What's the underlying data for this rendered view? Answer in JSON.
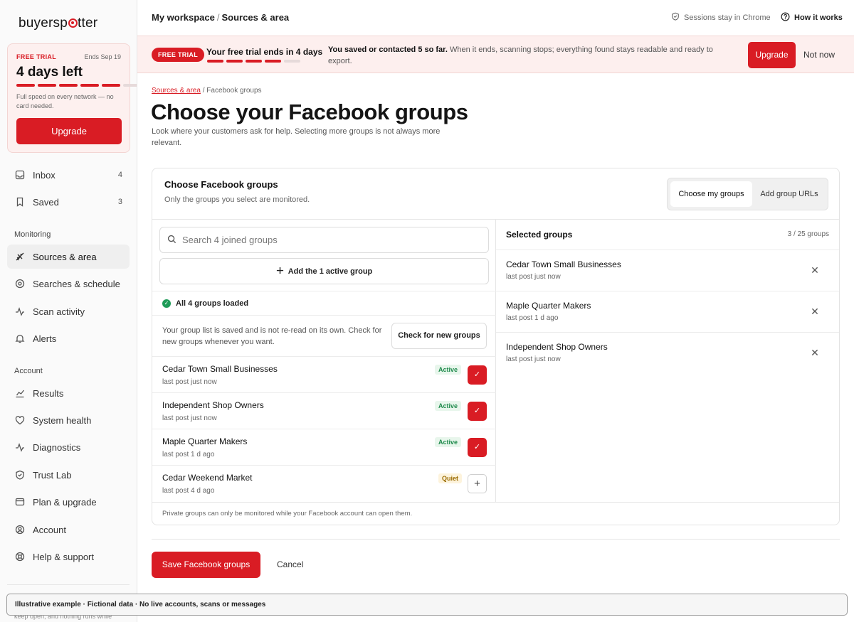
{
  "sidebar": {
    "logo_before": "buyersp",
    "logo_after": "tter",
    "trial": {
      "label": "FREE TRIAL",
      "ends": "Ends Sep 19",
      "days_left": "4 days left",
      "progress_filled_segments": 5,
      "progress_total_segments": 6,
      "note": "Full speed on every network — no card needed.",
      "upgrade_label": "Upgrade"
    },
    "top_items": [
      {
        "label": "Inbox",
        "count": "4",
        "icon": "inbox-icon"
      },
      {
        "label": "Saved",
        "count": "3",
        "icon": "bookmark-icon"
      }
    ],
    "monitoring_heading": "Monitoring",
    "monitoring_items": [
      {
        "label": "Sources & area",
        "icon": "radar-icon",
        "active": true
      },
      {
        "label": "Searches & schedule",
        "icon": "target-icon"
      },
      {
        "label": "Scan activity",
        "icon": "activity-icon"
      },
      {
        "label": "Alerts",
        "icon": "bell-icon"
      }
    ],
    "account_heading": "Account",
    "account_items": [
      {
        "label": "Results",
        "icon": "chart-icon"
      },
      {
        "label": "System health",
        "icon": "heart-icon"
      },
      {
        "label": "Diagnostics",
        "icon": "pulse-icon"
      },
      {
        "label": "Trust Lab",
        "icon": "shield-icon"
      },
      {
        "label": "Plan & upgrade",
        "icon": "card-icon"
      },
      {
        "label": "Account",
        "icon": "user-icon"
      },
      {
        "label": "Help & support",
        "icon": "lifebuoy-icon"
      }
    ],
    "footer_text": "keep open, and nothing runs while"
  },
  "topbar": {
    "breadcrumb_root": "My workspace",
    "breadcrumb_sep": "/",
    "breadcrumb_current": "Sources & area",
    "sessions_text": "Sessions stay in Chrome",
    "how_it_works": "How it works"
  },
  "banner": {
    "pill": "FREE TRIAL",
    "title": "Your free trial ends in 4 days",
    "progress_filled_segments": 5,
    "progress_total_segments": 6,
    "message_bold": "You saved or contacted 5 so far.",
    "message_rest": " When it ends, scanning stops; everything found stays readable and ready to export.",
    "upgrade_label": "Upgrade",
    "not_now_label": "Not now"
  },
  "main": {
    "subcrumb_link": "Sources & area",
    "subcrumb_rest": " / Facebook groups",
    "title": "Choose your Facebook groups",
    "description": "Look where your customers ask for help. Selecting more groups is not always more relevant.",
    "card": {
      "heading": "Choose Facebook groups",
      "subheading": "Only the groups you select are monitored.",
      "tab_mine": "Choose my groups",
      "tab_urls": "Add group URLs",
      "search_placeholder": "Search 4 joined groups",
      "add_active_label": "Add the 1 active group",
      "loaded_label": "All 4 groups loaded",
      "info_text": "Your group list is saved and is not re-read on its own. Check for new groups whenever you want.",
      "check_new_label": "Check for new groups",
      "groups": [
        {
          "name": "Cedar Town Small Businesses",
          "last_post": "last post just now",
          "status": "Active",
          "selected": true
        },
        {
          "name": "Independent Shop Owners",
          "last_post": "last post just now",
          "status": "Active",
          "selected": true
        },
        {
          "name": "Maple Quarter Makers",
          "last_post": "last post 1 d ago",
          "status": "Active",
          "selected": true
        },
        {
          "name": "Cedar Weekend Market",
          "last_post": "last post 4 d ago",
          "status": "Quiet",
          "selected": false
        }
      ],
      "selected_heading": "Selected groups",
      "selected_count": "3 / 25 groups",
      "selected": [
        {
          "name": "Cedar Town Small Businesses",
          "last_post": "last post just now"
        },
        {
          "name": "Maple Quarter Makers",
          "last_post": "last post 1 d ago"
        },
        {
          "name": "Independent Shop Owners",
          "last_post": "last post just now"
        }
      ],
      "footer_note": "Private groups can only be monitored while your Facebook account can open them."
    },
    "save_label": "Save Facebook groups",
    "cancel_label": "Cancel"
  },
  "disclaimer": "Illustrative example · Fictional data · No live accounts, scans or messages",
  "colors": {
    "accent": "#d91c24",
    "success": "#1e9b58",
    "quiet": "#9a6b00"
  }
}
